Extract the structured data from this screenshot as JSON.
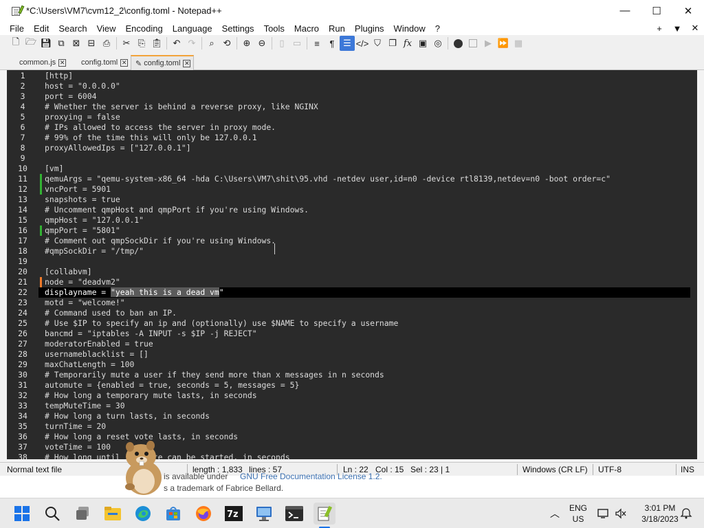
{
  "window": {
    "title": "*C:\\Users\\VM7\\cvm12_2\\config.toml - Notepad++",
    "minimize_glyph": "—",
    "maximize_glyph": "☐",
    "close_glyph": "✕"
  },
  "menu": {
    "items": [
      "File",
      "Edit",
      "Search",
      "View",
      "Encoding",
      "Language",
      "Settings",
      "Tools",
      "Macro",
      "Run",
      "Plugins",
      "Window",
      "?"
    ],
    "right": [
      "+",
      "▼",
      "✕"
    ]
  },
  "toolbar": {
    "icons": [
      "new-file-icon",
      "open-file-icon",
      "save-icon",
      "save-all-icon",
      "close-icon",
      "close-all-icon",
      "print-icon",
      "cut-icon",
      "copy-icon",
      "paste-icon",
      "undo-icon",
      "redo-icon",
      "find-icon",
      "replace-icon",
      "zoom-in-icon",
      "zoom-out-icon",
      "sync-vertical-icon",
      "sync-horizontal-icon",
      "word-wrap-icon",
      "show-all-characters-icon",
      "indent-guide-icon",
      "xml-tag-icon",
      "document-map-icon",
      "document-list-icon",
      "function-list-icon",
      "folder-as-workspace-icon",
      "monitoring-icon",
      "record-macro-icon",
      "stop-record-icon",
      "play-macro-icon",
      "run-macro-multiple-icon",
      "save-macro-icon"
    ]
  },
  "tabs": [
    {
      "label": "common.js",
      "close": "✕"
    },
    {
      "label": "config.toml",
      "close": "✕"
    },
    {
      "label": "config.toml",
      "close": "✕",
      "active": true,
      "modified_glyph": "✎"
    }
  ],
  "editor": {
    "selected_text": "\"yeah this is a dead vm",
    "lines": [
      {
        "n": "1",
        "text": "[http]"
      },
      {
        "n": "2",
        "text": "host = \"0.0.0.0\""
      },
      {
        "n": "3",
        "text": "port = 6004"
      },
      {
        "n": "4",
        "text": "# Whether the server is behind a reverse proxy, like NGINX"
      },
      {
        "n": "5",
        "text": "proxying = false"
      },
      {
        "n": "6",
        "text": "# IPs allowed to access the server in proxy mode."
      },
      {
        "n": "7",
        "text": "# 99% of the time this will only be 127.0.0.1"
      },
      {
        "n": "8",
        "text": "proxyAllowedIps = [\"127.0.0.1\"]"
      },
      {
        "n": "9",
        "text": ""
      },
      {
        "n": "10",
        "text": "[vm]"
      },
      {
        "n": "11",
        "text": "qemuArgs = \"qemu-system-x86_64 -hda C:\\Users\\VM7\\shit\\95.vhd -netdev user,id=n0 -device rtl8139,netdev=n0 -boot order=c\"",
        "marker": "green"
      },
      {
        "n": "12",
        "text": "vncPort = 5901",
        "marker": "green"
      },
      {
        "n": "13",
        "text": "snapshots = true"
      },
      {
        "n": "14",
        "text": "# Uncomment qmpHost and qmpPort if you're using Windows."
      },
      {
        "n": "15",
        "text": "qmpHost = \"127.0.0.1\""
      },
      {
        "n": "16",
        "text": "qmpPort = \"5801\"",
        "marker": "green"
      },
      {
        "n": "17",
        "text": "# Comment out qmpSockDir if you're using Windows."
      },
      {
        "n": "18",
        "text": "#qmpSockDir = \"/tmp/\""
      },
      {
        "n": "19",
        "text": ""
      },
      {
        "n": "20",
        "text": "[collabvm]"
      },
      {
        "n": "21",
        "text": "node = \"deadvm2\"",
        "marker": "orange"
      },
      {
        "n": "22",
        "text": "displayname = ",
        "sel": "\"yeah this is a dead vm",
        "after": "\"",
        "current": true
      },
      {
        "n": "23",
        "text": "motd = \"welcome!\""
      },
      {
        "n": "24",
        "text": "# Command used to ban an IP."
      },
      {
        "n": "25",
        "text": "# Use $IP to specify an ip and (optionally) use $NAME to specify a username"
      },
      {
        "n": "26",
        "text": "bancmd = \"iptables -A INPUT -s $IP -j REJECT\""
      },
      {
        "n": "27",
        "text": "moderatorEnabled = true"
      },
      {
        "n": "28",
        "text": "usernameblacklist = []"
      },
      {
        "n": "29",
        "text": "maxChatLength = 100"
      },
      {
        "n": "30",
        "text": "# Temporarily mute a user if they send more than x messages in n seconds"
      },
      {
        "n": "31",
        "text": "automute = {enabled = true, seconds = 5, messages = 5}"
      },
      {
        "n": "32",
        "text": "# How long a temporary mute lasts, in seconds"
      },
      {
        "n": "33",
        "text": "tempMuteTime = 30"
      },
      {
        "n": "34",
        "text": "# How long a turn lasts, in seconds"
      },
      {
        "n": "35",
        "text": "turnTime = 20"
      },
      {
        "n": "36",
        "text": "# How long a reset vote lasts, in seconds"
      },
      {
        "n": "37",
        "text": "voteTime = 100"
      },
      {
        "n": "38",
        "text": "# How long until     vote can be started, in seconds"
      }
    ]
  },
  "status": {
    "type": "Normal text file",
    "length": "length : 1,833",
    "lines": "lines : 57",
    "ln": "Ln : 22",
    "col": "Col : 15",
    "sel": "Sel : 23 | 1",
    "eol": "Windows (CR LF)",
    "encoding": "UTF-8",
    "mode": "INS"
  },
  "behind_window": {
    "line1_a": "is available under ",
    "line1_b": "GNU Free Documentation License 1.2.",
    "line2": "s a trademark of Fabrice Bellard."
  },
  "taskbar": {
    "apps": [
      "start-icon",
      "search-icon",
      "task-view-icon",
      "file-explorer-icon",
      "edge-icon",
      "microsoft-store-icon",
      "firefox-icon",
      "7zip-icon",
      "remote-desktop-icon",
      "terminal-icon",
      "notepad-plus-plus-icon"
    ],
    "lang_top": "ENG",
    "lang_bottom": "US",
    "time": "3:01 PM",
    "date": "3/18/2023",
    "chevron": "︿"
  }
}
